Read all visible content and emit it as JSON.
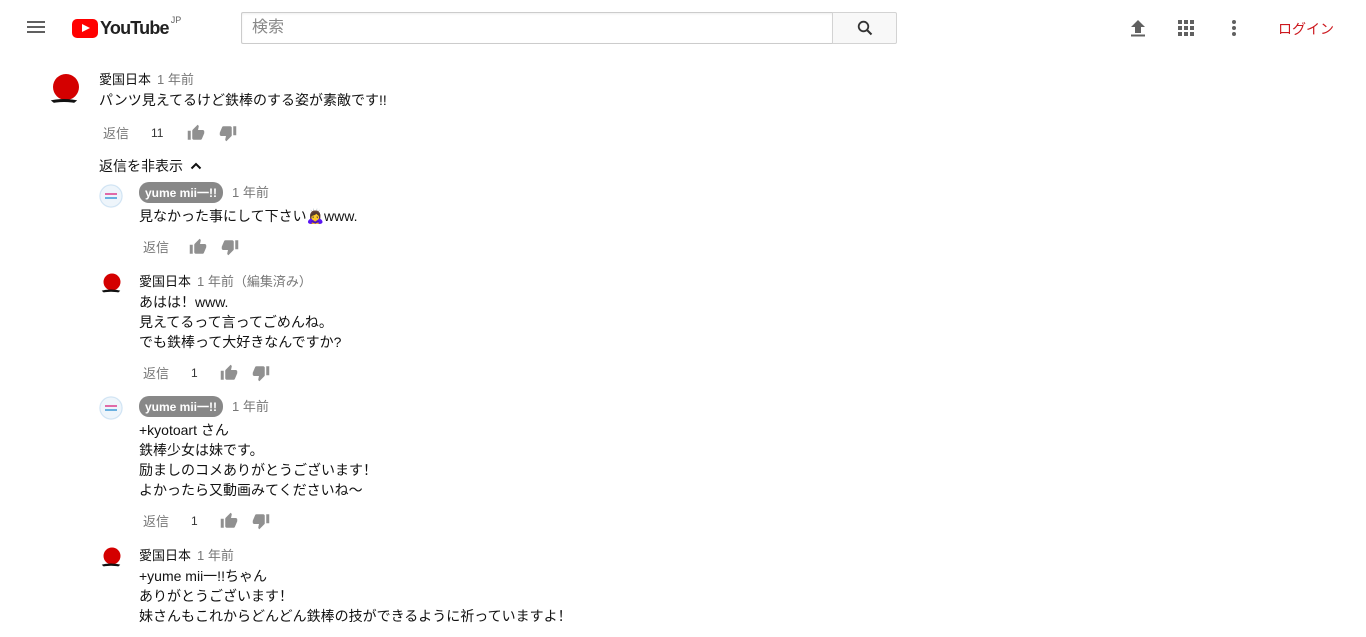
{
  "header": {
    "logo_text": "YouTube",
    "logo_region": "JP",
    "search_placeholder": "検索",
    "login_label": "ログイン"
  },
  "comments": {
    "main": {
      "author": "愛国日本",
      "time": "1 年前",
      "text": "パンツ見えてるけど鉄棒のする姿が素敵です!!",
      "reply_label": "返信",
      "likes": "11"
    },
    "hide_replies_label": "返信を非表示",
    "replies": [
      {
        "author": "yume mii一!!",
        "time": "1 年前",
        "lines": [
          "見なかった事にして下さい🙇‍♀️www."
        ],
        "reply_label": "返信",
        "likes": ""
      },
      {
        "author": "愛国日本",
        "time": "1 年前（編集済み）",
        "lines": [
          "あはは！www.",
          "見えてるって言ってごめんね。",
          "でも鉄棒って大好きなんですか?"
        ],
        "reply_label": "返信",
        "likes": "1"
      },
      {
        "author": "yume mii一!!",
        "time": "1 年前",
        "lines": [
          "+kyotoart さん",
          "鉄棒少女は妹です。",
          "励ましのコメありがとうございます！",
          "よかったら又動画みてくださいね〜"
        ],
        "reply_label": "返信",
        "likes": "1"
      },
      {
        "author": "愛国日本",
        "time": "1 年前",
        "lines": [
          "+yume mii一!!ちゃん",
          "ありがとうございます！",
          "妹さんもこれからどんどん鉄棒の技ができるように祈っていますよ！"
        ],
        "reply_label": "",
        "likes": ""
      }
    ]
  },
  "colors": {
    "brand_red": "#ff0000",
    "login_red": "#cc181e",
    "chip_gray": "#888888"
  }
}
